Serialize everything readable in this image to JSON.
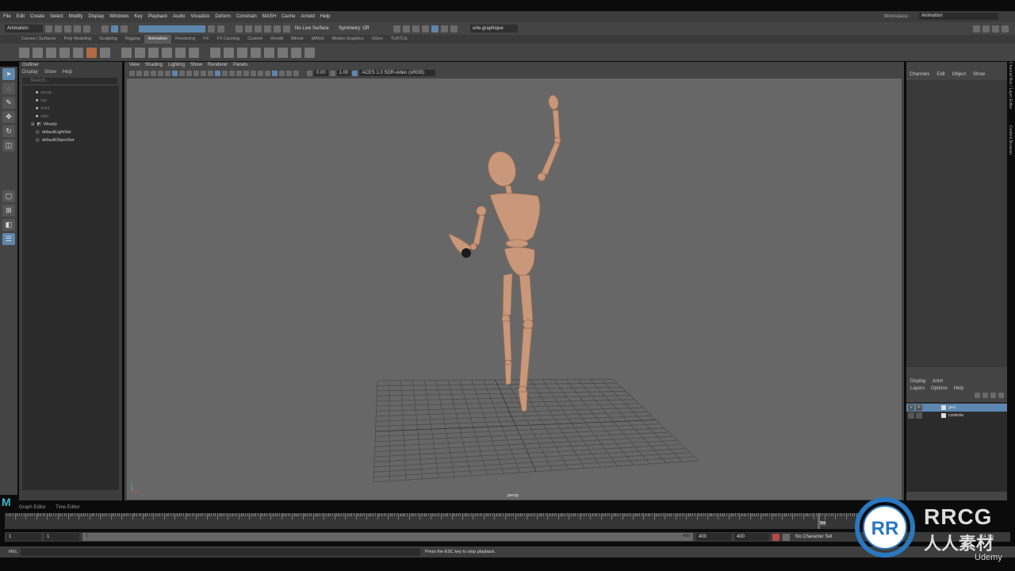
{
  "menubar": {
    "items": [
      "File",
      "Edit",
      "Create",
      "Select",
      "Modify",
      "Display",
      "Windows",
      "Key",
      "Playback",
      "Audio",
      "Visualize",
      "Deform",
      "Constrain",
      "MASH",
      "Cache",
      "Arnold",
      "Help"
    ],
    "workspace_label": "Workspace :",
    "workspace_value": "Animation"
  },
  "statusline": {
    "mode": "Animation",
    "live_surface": "No Live Surface",
    "symmetry": "Symmetry: Off",
    "user": "urte.graphique"
  },
  "shelf_tabs": [
    "Curves / Surfaces",
    "Poly Modeling",
    "Sculpting",
    "Rigging",
    "Animation",
    "Rendering",
    "FX",
    "FX Caching",
    "Custom",
    "Arnold",
    "Bifrost",
    "MASH",
    "Motion Graphics",
    "XGen",
    "TURTLE"
  ],
  "shelf_active": "Animation",
  "outliner": {
    "title": "Outliner",
    "menu": [
      "Display",
      "Show",
      "Help"
    ],
    "search_placeholder": "Search...",
    "items": [
      {
        "label": "persp",
        "type": "camera"
      },
      {
        "label": "top",
        "type": "camera"
      },
      {
        "label": "front",
        "type": "camera"
      },
      {
        "label": "side",
        "type": "camera"
      },
      {
        "label": "Woody",
        "type": "group"
      },
      {
        "label": "defaultLightSet",
        "type": "set"
      },
      {
        "label": "defaultObjectSet",
        "type": "set"
      }
    ]
  },
  "viewport": {
    "menu": [
      "View",
      "Shading",
      "Lighting",
      "Show",
      "Renderer",
      "Panels"
    ],
    "near_value": "0.00",
    "far_value": "1.00",
    "color_space": "ACES 1.0 SDR-video (sRGB)",
    "camera_label": "persp"
  },
  "channel_box": {
    "menu": [
      "Channels",
      "Edit",
      "Object",
      "Show"
    ],
    "side_tabs": [
      "Channel Box / Layer Editor",
      "Content Browser"
    ]
  },
  "layer_editor": {
    "tabs": [
      "Display",
      "Anim"
    ],
    "menu": [
      "Layers",
      "Options",
      "Help"
    ],
    "layers": [
      {
        "name": "geo",
        "v": "V",
        "p": "P",
        "selected": true
      },
      {
        "name": "controls",
        "v": "",
        "p": "",
        "selected": false
      }
    ]
  },
  "time_tabs": [
    "Graph Editor",
    "Time Editor"
  ],
  "time_slider": {
    "current_frame": "366",
    "ticks": [
      "5",
      "10",
      "15",
      "20",
      "25",
      "30",
      "35",
      "40",
      "45",
      "50",
      "55",
      "60",
      "65",
      "70",
      "75",
      "80",
      "85",
      "90",
      "95",
      "100",
      "105",
      "110",
      "115",
      "120",
      "125",
      "130",
      "135",
      "140",
      "145",
      "150",
      "155",
      "160",
      "165",
      "170",
      "175",
      "180",
      "185",
      "190",
      "195",
      "200",
      "205",
      "210",
      "215",
      "220",
      "225",
      "230",
      "235",
      "240",
      "245",
      "250",
      "255",
      "260",
      "265",
      "270",
      "275",
      "280",
      "285",
      "290",
      "295",
      "300",
      "305",
      "310",
      "315",
      "320",
      "325",
      "330",
      "335",
      "340",
      "345",
      "350",
      "355",
      "360",
      "365",
      "370",
      "375"
    ]
  },
  "range_slider": {
    "start": "1",
    "anim_start": "1",
    "range_start_label": "1",
    "range_end_label": "400",
    "end": "400",
    "anim_end": "400",
    "character_set": "No Character Set",
    "fps": "24 fps"
  },
  "command_line": {
    "language": "MEL",
    "help_text": "Press the ESC key to stop playback."
  },
  "watermark": {
    "brand": "RRCG",
    "subtitle": "人人素材",
    "udemy": "Udemy"
  },
  "colors": {
    "accent": "#5d87b0",
    "figure": "#c9977a",
    "viewport_bg": "#676767"
  }
}
